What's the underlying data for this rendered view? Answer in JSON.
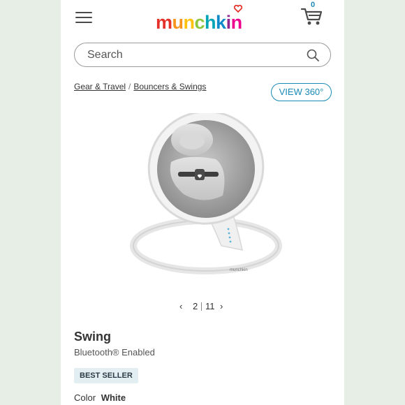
{
  "header": {
    "menu_icon": "hamburger-menu-icon",
    "logo_text": "munchkin",
    "logo_letters": [
      "m",
      "u",
      "n",
      "c",
      "h",
      "k",
      "i",
      "n"
    ],
    "logo_colors": [
      "#e4322b",
      "#f7941d",
      "#ffc20e",
      "#8dc63f",
      "#00a5b5",
      "#0e8ac9",
      "#92278f",
      "#ec008c"
    ],
    "cart_icon": "shopping-cart-icon",
    "cart_count": "0"
  },
  "search": {
    "placeholder": "Search",
    "value": "",
    "icon": "search-icon"
  },
  "breadcrumb": {
    "items": [
      "Gear & Travel",
      "Bouncers & Swings"
    ],
    "separator": "/"
  },
  "view360": {
    "label": "VIEW 360°"
  },
  "gallery": {
    "current": "2",
    "total": "11",
    "prev_icon": "chevron-left-icon",
    "next_icon": "chevron-right-icon"
  },
  "product": {
    "name": "Swing",
    "tagline": "Bluetooth® Enabled",
    "badge": "BEST SELLER",
    "color_label": "Color",
    "color_value": "White",
    "image_brand_text": "munchkin"
  },
  "colors": {
    "accent": "#1a8ab5",
    "badge_bg": "#e3eef3",
    "outer_bg": "#e7eee5"
  }
}
